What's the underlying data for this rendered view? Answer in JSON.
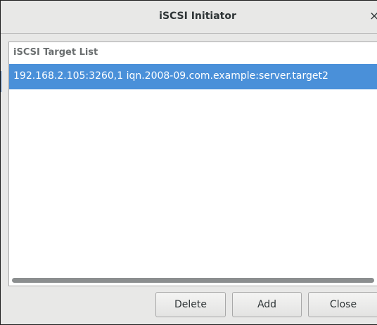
{
  "window": {
    "title": "iSCSI Initiator",
    "close_glyph": "×"
  },
  "list": {
    "column_header": "iSCSI Target List",
    "rows": [
      {
        "text": "192.168.2.105:3260,1 iqn.2008-09.com.example:server.target2",
        "selected": true
      }
    ]
  },
  "buttons": {
    "delete": "Delete",
    "add": "Add",
    "close": "Close"
  },
  "colors": {
    "selection": "#4a90d9",
    "window_bg": "#e8e8e7"
  }
}
